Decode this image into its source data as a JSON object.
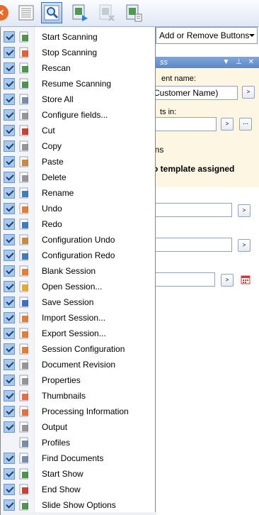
{
  "toolbar": {
    "buttons": [
      {
        "name": "start-scan-icon",
        "color": "#e8632a"
      },
      {
        "name": "document-list-icon"
      },
      {
        "name": "magnifier-icon",
        "pressed": true
      },
      {
        "name": "scan-show-icon"
      },
      {
        "name": "end-show-icon"
      },
      {
        "name": "slide-show-icon"
      }
    ]
  },
  "add_remove_label": "Add or Remove Buttons",
  "panel": {
    "caption": "ss",
    "caption_controls": "▼ ⊥ ✕",
    "document_name_label": "ent name:",
    "document_name_value": "Customer Name)",
    "puts_in_label": "ts in:",
    "options_header": "ons",
    "no_template": "o template assigned",
    "browse_label": "...",
    "go_label": ">"
  },
  "menu": {
    "items": [
      {
        "label": "Start Scanning",
        "checked": true,
        "icon": "start-scanning-icon",
        "color": "#3a8a3a"
      },
      {
        "label": "Stop Scanning",
        "checked": true,
        "icon": "stop-scanning-icon",
        "color": "#e05020"
      },
      {
        "label": "Rescan",
        "checked": true,
        "icon": "rescan-icon",
        "color": "#3a8a3a"
      },
      {
        "label": "Resume Scanning",
        "checked": true,
        "icon": "resume-scanning-icon",
        "color": "#3a8a3a"
      },
      {
        "label": "Store All",
        "checked": true,
        "icon": "store-all-icon",
        "color": "#6a7fa0"
      },
      {
        "label": "Configure fields...",
        "checked": true,
        "icon": "configure-fields-icon",
        "color": "#8a8a8a"
      },
      {
        "label": "Cut",
        "checked": true,
        "icon": "cut-icon",
        "color": "#c03020"
      },
      {
        "label": "Copy",
        "checked": true,
        "icon": "copy-icon",
        "color": "#8a8a8a"
      },
      {
        "label": "Paste",
        "checked": true,
        "icon": "paste-icon",
        "color": "#c08030"
      },
      {
        "label": "Delete",
        "checked": true,
        "icon": "delete-icon",
        "color": "#8a8a8a"
      },
      {
        "label": "Rename",
        "checked": true,
        "icon": "rename-icon",
        "color": "#2a70b0"
      },
      {
        "label": "Undo",
        "checked": true,
        "icon": "undo-icon",
        "color": "#e07020"
      },
      {
        "label": "Redo",
        "checked": true,
        "icon": "redo-icon",
        "color": "#2a70b0"
      },
      {
        "label": "Configuration Undo",
        "checked": true,
        "icon": "configuration-undo-icon",
        "color": "#c08030"
      },
      {
        "label": "Configuration Redo",
        "checked": true,
        "icon": "configuration-redo-icon",
        "color": "#2a70b0"
      },
      {
        "label": "Blank Session",
        "checked": true,
        "icon": "blank-session-icon",
        "color": "#e07020"
      },
      {
        "label": "Open Session...",
        "checked": true,
        "icon": "open-session-icon",
        "color": "#e0a020"
      },
      {
        "label": "Save Session",
        "checked": true,
        "icon": "save-session-icon",
        "color": "#2a60b0"
      },
      {
        "label": "Import Session...",
        "checked": true,
        "icon": "import-session-icon",
        "color": "#e07020"
      },
      {
        "label": "Export Session...",
        "checked": true,
        "icon": "export-session-icon",
        "color": "#e07020"
      },
      {
        "label": "Session Configuration",
        "checked": true,
        "icon": "session-configuration-icon",
        "color": "#e07020"
      },
      {
        "label": "Document Revision",
        "checked": true,
        "icon": "document-revision-icon",
        "color": "#8a8a8a"
      },
      {
        "label": "Properties",
        "checked": true,
        "icon": "properties-icon",
        "color": "#8a8a8a"
      },
      {
        "label": "Thumbnails",
        "checked": true,
        "icon": "thumbnails-icon",
        "color": "#e06030"
      },
      {
        "label": "Processing Information",
        "checked": true,
        "icon": "processing-information-icon",
        "color": "#e06030"
      },
      {
        "label": "Output",
        "checked": true,
        "icon": "output-icon",
        "color": "#8a8a8a"
      },
      {
        "label": "Profiles",
        "checked": false,
        "icon": "profiles-icon",
        "color": "#6a7fa0"
      },
      {
        "label": "Find Documents",
        "checked": true,
        "icon": "find-documents-icon",
        "color": "#6a7fa0"
      },
      {
        "label": "Start Show",
        "checked": true,
        "icon": "start-show-icon",
        "color": "#3a8a3a"
      },
      {
        "label": "End Show",
        "checked": true,
        "icon": "end-show-icon",
        "color": "#c03020"
      },
      {
        "label": "Slide Show Options",
        "checked": true,
        "icon": "slide-show-options-icon",
        "color": "#3a8a3a"
      }
    ]
  }
}
